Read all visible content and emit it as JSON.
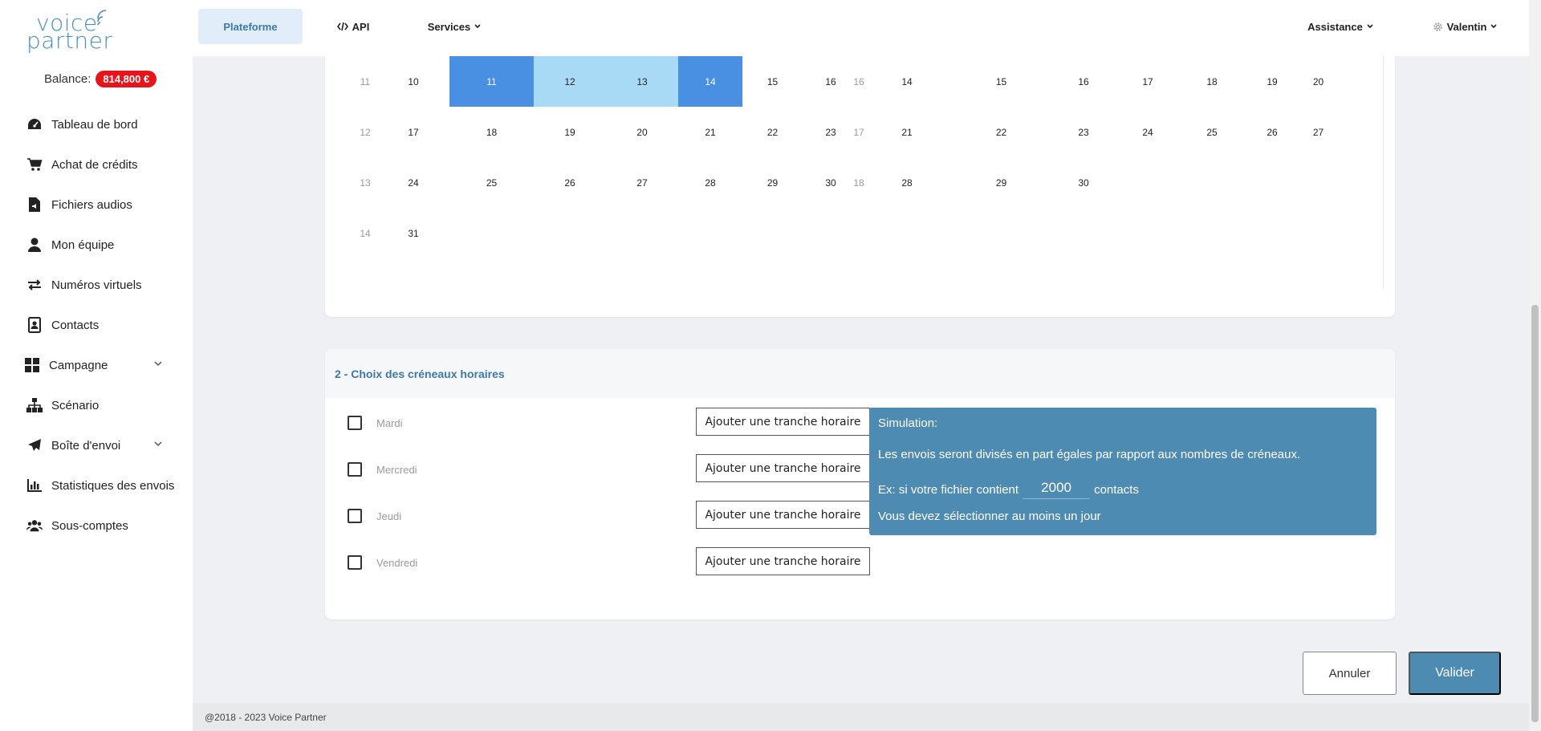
{
  "brand": {
    "line1": "voice",
    "line2": "partner"
  },
  "balance": {
    "label": "Balance:",
    "value": "814,800 €"
  },
  "sidebar": {
    "items": [
      {
        "label": "Tableau de bord",
        "icon": "dashboard-icon"
      },
      {
        "label": "Achat de crédits",
        "icon": "cart-icon"
      },
      {
        "label": "Fichiers audios",
        "icon": "audio-file-icon"
      },
      {
        "label": "Mon équipe",
        "icon": "user-icon"
      },
      {
        "label": "Numéros virtuels",
        "icon": "exchange-icon"
      },
      {
        "label": "Contacts",
        "icon": "contact-card-icon"
      },
      {
        "label": "Campagne",
        "icon": "grid-icon",
        "has_chevron": true
      },
      {
        "label": "Scénario",
        "icon": "sitemap-icon"
      },
      {
        "label": "Boîte d'envoi",
        "icon": "paper-plane-icon",
        "has_chevron": true
      },
      {
        "label": "Statistiques des envois",
        "icon": "bar-chart-icon"
      },
      {
        "label": "Sous-comptes",
        "icon": "users-icon"
      }
    ]
  },
  "topnav": {
    "plateforme": "Plateforme",
    "api": "API",
    "services": "Services",
    "assistance": "Assistance",
    "user": "Valentin"
  },
  "calendar": {
    "month1": {
      "rows": [
        {
          "week": "11",
          "days": [
            "10",
            "11",
            "12",
            "13",
            "14",
            "15",
            "16"
          ]
        },
        {
          "week": "12",
          "days": [
            "17",
            "18",
            "19",
            "20",
            "21",
            "22",
            "23"
          ]
        },
        {
          "week": "13",
          "days": [
            "24",
            "25",
            "26",
            "27",
            "28",
            "29",
            "30"
          ]
        },
        {
          "week": "14",
          "days": [
            "31",
            "",
            "",
            "",
            "",
            "",
            ""
          ]
        }
      ]
    },
    "month2": {
      "rows": [
        {
          "week": "16",
          "days": [
            "14",
            "15",
            "16",
            "17",
            "18",
            "19",
            "20"
          ]
        },
        {
          "week": "17",
          "days": [
            "21",
            "22",
            "23",
            "24",
            "25",
            "26",
            "27"
          ]
        },
        {
          "week": "18",
          "days": [
            "28",
            "29",
            "30",
            "",
            "",
            "",
            ""
          ]
        }
      ]
    },
    "selected_start": "11",
    "selected_end": "14",
    "colors": {
      "selected": "#4a90e2",
      "range": "#a8daf6"
    }
  },
  "slots": {
    "title": "2 - Choix des créneaux horaires",
    "days": [
      {
        "label": "Mardi",
        "checked": false,
        "button": "Ajouter une tranche horaire"
      },
      {
        "label": "Mercredi",
        "checked": false,
        "button": "Ajouter une tranche horaire"
      },
      {
        "label": "Jeudi",
        "checked": false,
        "button": "Ajouter une tranche horaire"
      },
      {
        "label": "Vendredi",
        "checked": false,
        "button": "Ajouter une tranche horaire"
      }
    ],
    "simulation": {
      "title": "Simulation:",
      "line1": "Les envois seront divisés en part égales par rapport aux nombres de créneaux.",
      "ex_prefix": "Ex: si votre fichier contient",
      "contacts_value": "2000",
      "ex_suffix": "contacts",
      "warning": "Vous devez sélectionner au moins un jour"
    }
  },
  "actions": {
    "cancel": "Annuler",
    "ok": "Valider"
  },
  "footer": {
    "text": "@2018 - 2023 Voice Partner"
  }
}
